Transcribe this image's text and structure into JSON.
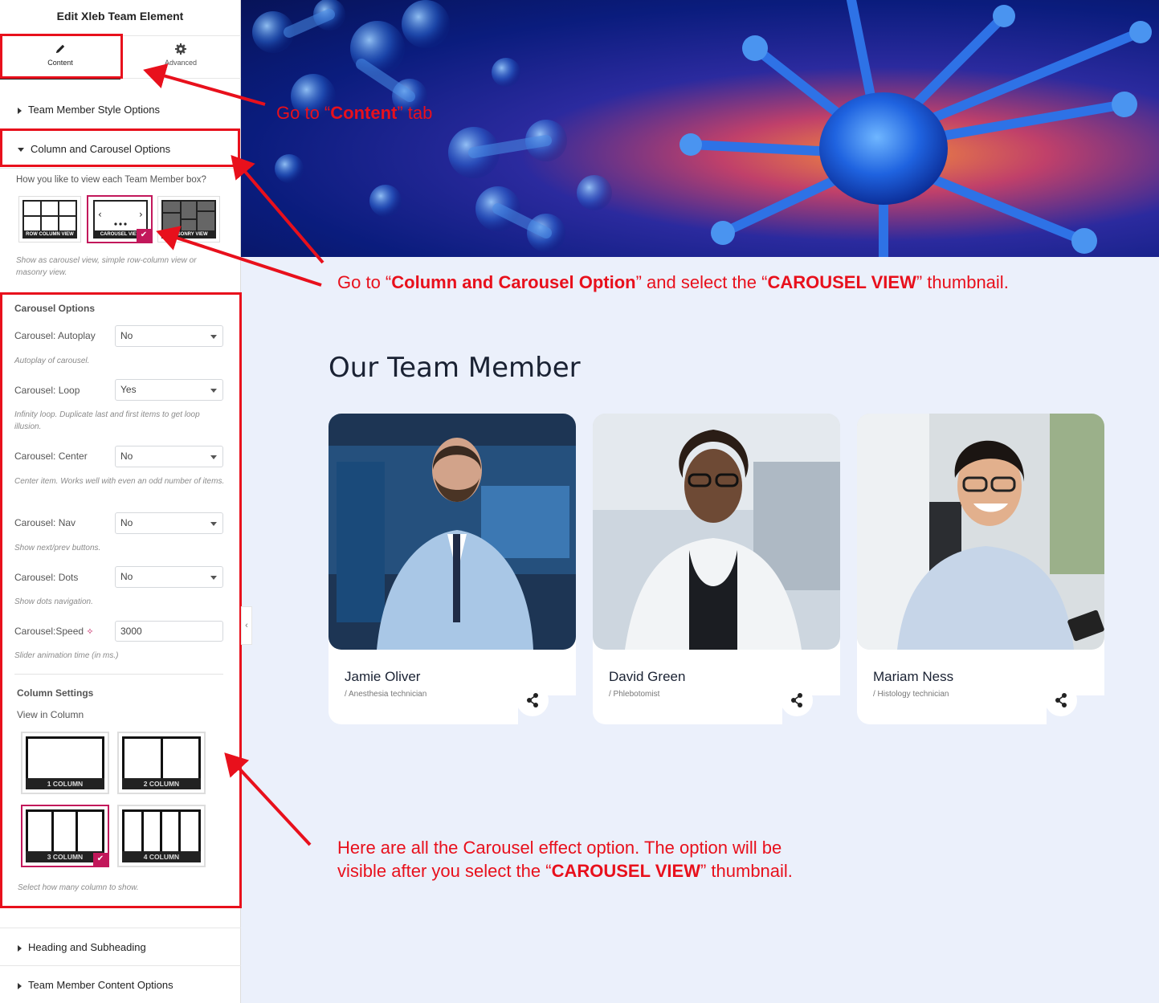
{
  "panel": {
    "title": "Edit Xleb Team Element",
    "tabs": {
      "content": "Content",
      "advanced": "Advanced"
    },
    "sections": {
      "style": "Team Member Style Options",
      "column_carousel": "Column and Carousel Options",
      "heading": "Heading and Subheading",
      "content_options": "Team Member Content Options"
    },
    "view_question": "How you like to view each Team Member box?",
    "views": {
      "row": "ROW COLUMN VIEW",
      "carousel": "CAROUSEL VIEW",
      "masonry": "MASONRY VIEW"
    },
    "view_note": "Show as carousel view, simple row-column view or masonry view.",
    "carousel_options_title": "Carousel Options",
    "autoplay": {
      "label": "Carousel: Autoplay",
      "value": "No",
      "note": "Autoplay of carousel."
    },
    "loop": {
      "label": "Carousel: Loop",
      "value": "Yes",
      "note": "Infinity loop. Duplicate last and first items to get loop illusion."
    },
    "center": {
      "label": "Carousel: Center",
      "value": "No",
      "note": "Center item. Works well with even an odd number of items."
    },
    "nav": {
      "label": "Carousel: Nav",
      "value": "No",
      "note": "Show next/prev buttons."
    },
    "dots": {
      "label": "Carousel: Dots",
      "value": "No",
      "note": "Show dots navigation."
    },
    "speed": {
      "label": "Carousel:Speed",
      "value": "3000",
      "note": "Slider animation time (in ms.)"
    },
    "column_settings_title": "Column Settings",
    "view_in_column": "View in Column",
    "columns": {
      "c1": "1 COLUMN",
      "c2": "2 COLUMN",
      "c3": "3 COLUMN",
      "c4": "4 COLUMN"
    },
    "column_note": "Select how many column to show."
  },
  "main": {
    "title": "Our Team Member",
    "members": [
      {
        "name": "Jamie Oliver",
        "role": "/  Anesthesia technician"
      },
      {
        "name": "David Green",
        "role": "/  Phlebotomist"
      },
      {
        "name": "Mariam Ness",
        "role": "/  Histology technician"
      }
    ]
  },
  "annotations": {
    "content_tab": {
      "a": "Go  to “",
      "b": "Content",
      "c": "” tab"
    },
    "carousel_option": {
      "a": "Go to “",
      "b": "Column and Carousel Option",
      "c": "” and select the “",
      "d": "CAROUSEL VIEW",
      "e": "” thumbnail."
    },
    "carousel_effects": {
      "line1": "Here are all the Carousel effect option. The option will be",
      "a": "visible after you select the “",
      "b": "CAROUSEL VIEW",
      "c": "” thumbnail."
    }
  },
  "colors": {
    "accent": "#c2185b",
    "annotation": "#e8101c",
    "page_bg": "#ebf0fb"
  }
}
